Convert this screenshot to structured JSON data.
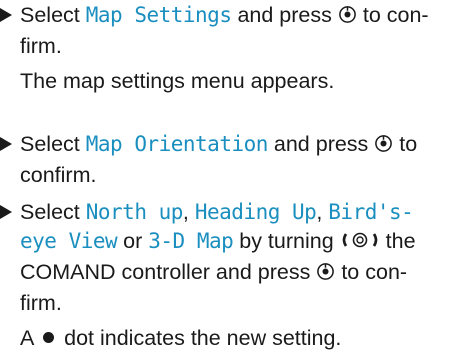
{
  "steps": [
    {
      "select": "Select",
      "keyword": "Map Settings",
      "press": "and press",
      "confirm_a": "to con-",
      "confirm_b": "firm.",
      "result": "The map settings menu appears."
    },
    {
      "select": "Select",
      "keyword": "Map Orientation",
      "press": "and press",
      "to": "to",
      "confirm": "confirm."
    },
    {
      "select": "Select",
      "options": [
        "North up",
        "Heading Up",
        "Bird's-",
        "eye View",
        "3-D Map"
      ],
      "sep_comma": ",",
      "sep_or": "or",
      "turning": "by turning",
      "controller": "the",
      "controller_b": "COMAND controller and press",
      "confirm_a": "to con-",
      "confirm_b": "firm.",
      "result_a": "A",
      "result_b": "dot indicates the new setting."
    }
  ],
  "icons": {
    "press": "press-controller-icon",
    "turn": "turn-controller-icon",
    "dot": "bullet-dot-icon"
  }
}
